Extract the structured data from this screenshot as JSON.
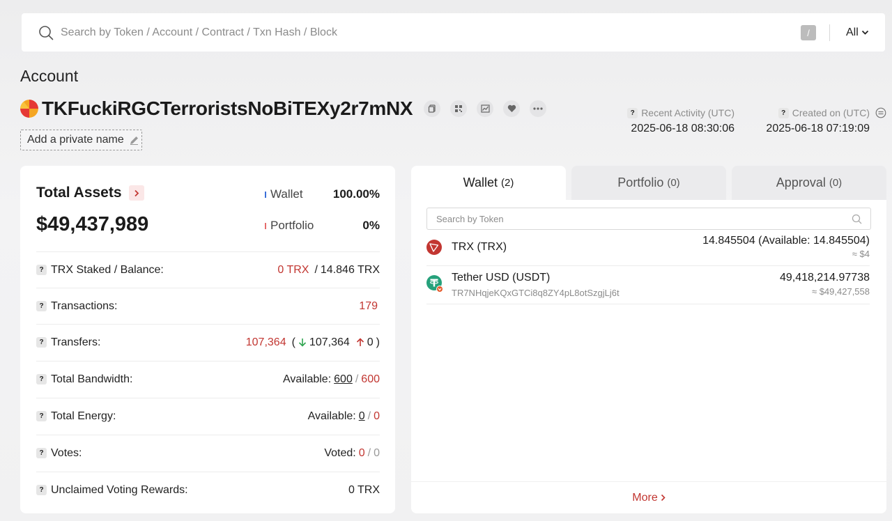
{
  "search": {
    "placeholder": "Search by Token / Account / Contract / Txn Hash / Block",
    "shortcut_key": "/",
    "filter_label": "All"
  },
  "account": {
    "page_title": "Account",
    "address": "TKFuckiRGCTerroristsNoBiTEXy2r7mNX",
    "private_name_label": "Add a private name",
    "recent_activity_label": "Recent Activity (UTC)",
    "recent_activity_value": "2025-06-18 08:30:06",
    "created_on_label": "Created on (UTC)",
    "created_on_value": "2025-06-18 07:19:09"
  },
  "assets": {
    "title": "Total Assets",
    "total_value": "$49,437,989",
    "allocation": [
      {
        "name": "Wallet",
        "pct": "100.00%",
        "color": "#3b6fd8"
      },
      {
        "name": "Portfolio",
        "pct": "0%",
        "color": "#e56b6b"
      }
    ]
  },
  "stats": {
    "trx_staked": {
      "label": "TRX Staked / Balance:",
      "staked": "0 TRX",
      "sep": "/",
      "balance": "14.846 TRX"
    },
    "transactions": {
      "label": "Transactions:",
      "value": "179"
    },
    "transfers": {
      "label": "Transfers:",
      "total": "107,364",
      "open": "(",
      "in": "107,364",
      "out": "0",
      "close": ")"
    },
    "bandwidth": {
      "label": "Total Bandwidth:",
      "prefix": "Available:",
      "available": "600",
      "sep": "/",
      "total": "600"
    },
    "energy": {
      "label": "Total Energy:",
      "prefix": "Available:",
      "available": "0",
      "sep": "/",
      "total": "0"
    },
    "votes": {
      "label": "Votes:",
      "prefix": "Voted:",
      "voted": "0",
      "sep": "/",
      "total": "0"
    },
    "rewards": {
      "label": "Unclaimed Voting Rewards:",
      "value": "0 TRX"
    }
  },
  "tabs": [
    {
      "label": "Wallet",
      "count": "(2)"
    },
    {
      "label": "Portfolio",
      "count": "(0)"
    },
    {
      "label": "Approval",
      "count": "(0)"
    }
  ],
  "wallet": {
    "search_placeholder": "Search by Token",
    "tokens": [
      {
        "name": "TRX (TRX)",
        "amount": "14.845504 (Available: 14.845504)",
        "usd": "≈ $4",
        "icon": "trx-icon"
      },
      {
        "name": "Tether USD (USDT)",
        "contract": "TR7NHqjeKQxGTCi8q8ZY4pL8otSzgjLj6t",
        "amount": "49,418,214.97738",
        "usd": "≈ $49,427,558",
        "icon": "usdt-icon"
      }
    ],
    "more_label": "More"
  },
  "colors": {
    "accent_red": "#c23631",
    "transfer_in": "#2ea44f",
    "transfer_out": "#c23631"
  }
}
